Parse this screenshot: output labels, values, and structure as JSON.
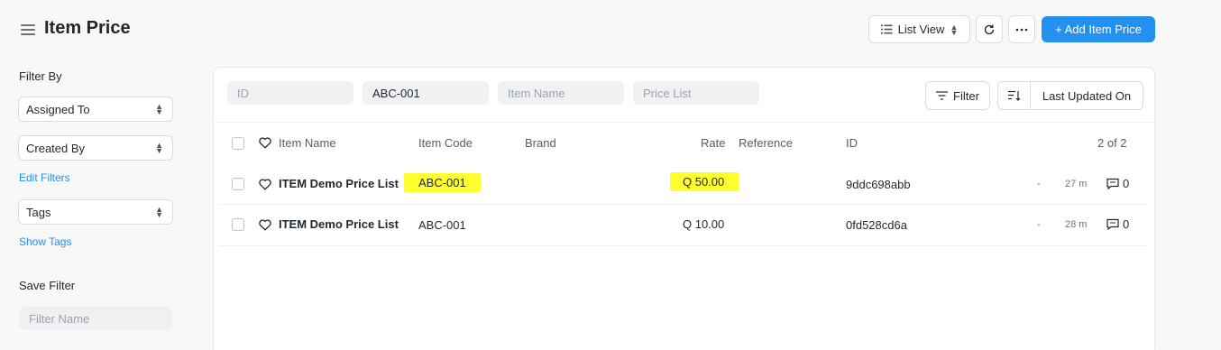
{
  "header": {
    "title": "Item Price",
    "list_view_label": "List View",
    "add_label": "+ Add Item Price"
  },
  "sidebar": {
    "filter_by_label": "Filter By",
    "assigned_to": "Assigned To",
    "created_by": "Created By",
    "edit_filters": "Edit Filters",
    "tags": "Tags",
    "show_tags": "Show Tags",
    "save_filter_label": "Save Filter",
    "filter_name_placeholder": "Filter Name"
  },
  "filters": {
    "id_placeholder": "ID",
    "item_code_value": "ABC-001",
    "item_name_placeholder": "Item Name",
    "price_list_placeholder": "Price List",
    "filter_label": "Filter",
    "sort_label": "Last Updated On"
  },
  "table": {
    "columns": {
      "item_name": "Item Name",
      "item_code": "Item Code",
      "brand": "Brand",
      "rate": "Rate",
      "reference": "Reference",
      "id": "ID"
    },
    "count": "2 of 2",
    "rows": [
      {
        "item_name": "ITEM Demo Price List",
        "item_code": "ABC-001",
        "rate": "Q 50.00",
        "id": "9ddc698abb",
        "dash": "-",
        "modified": "27 m",
        "comments": "0"
      },
      {
        "item_name": "ITEM Demo Price List",
        "item_code": "ABC-001",
        "rate": "Q 10.00",
        "id": "0fd528cd6a",
        "dash": "-",
        "modified": "28 m",
        "comments": "0"
      }
    ]
  },
  "colors": {
    "primary": "#2490ef",
    "highlight": "#ffff2e"
  }
}
